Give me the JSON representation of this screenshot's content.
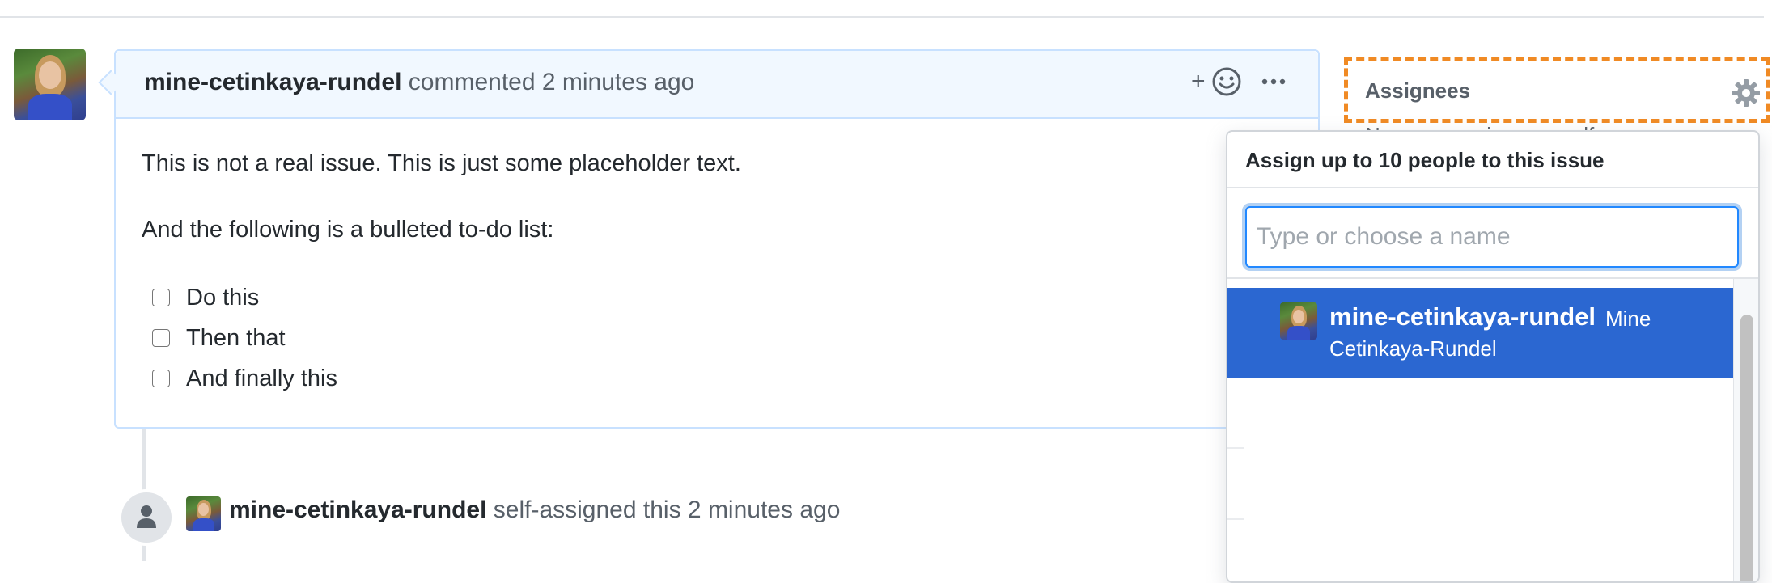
{
  "comment": {
    "author": "mine-cetinkaya-rundel",
    "action": "commented",
    "time": "2 minutes ago",
    "emoji_button": "+",
    "body": {
      "paragraph1": "This is not a real issue. This is just some placeholder text.",
      "paragraph2": "And the following is a bulleted to-do list:",
      "tasks": [
        {
          "label": "Do this",
          "checked": false
        },
        {
          "label": "Then that",
          "checked": false
        },
        {
          "label": "And finally this",
          "checked": false
        }
      ]
    }
  },
  "event": {
    "actor": "mine-cetinkaya-rundel",
    "action": "self-assigned this",
    "time": "2 minutes ago"
  },
  "sidebar": {
    "assignees_label": "Assignees",
    "assignees_subtext": "No one—assign yourself"
  },
  "assignee_popover": {
    "title": "Assign up to 10 people to this issue",
    "filter_placeholder": "Type or choose a name",
    "filter_value": "",
    "items": [
      {
        "login": "mine-cetinkaya-rundel",
        "name_line1": "Mine",
        "name_line2": "Cetinkaya-Rundel",
        "selected": true
      }
    ]
  },
  "colors": {
    "highlight_outline": "#f08a24",
    "selected_row": "#2b67d1",
    "comment_header": "#f1f8ff"
  }
}
